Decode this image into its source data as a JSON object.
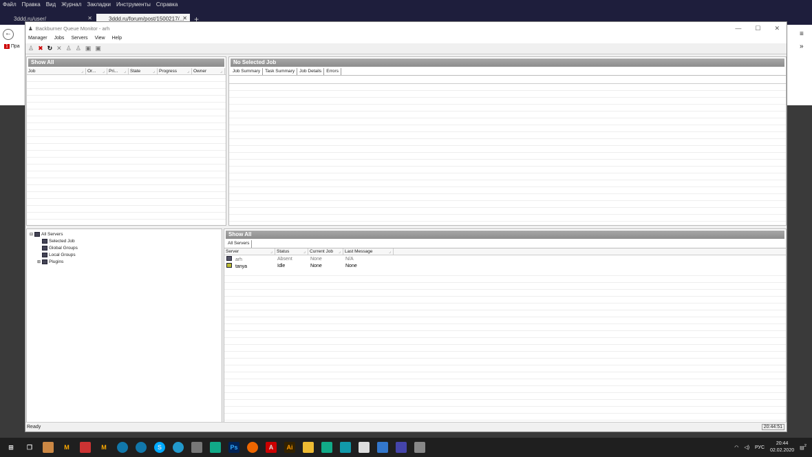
{
  "browser": {
    "menu": [
      "Файл",
      "Правка",
      "Вид",
      "Журнал",
      "Закладки",
      "Инструменты",
      "Справка"
    ],
    "tabs": [
      {
        "label": "3ddd.ru/user/"
      },
      {
        "label": "3ddd.ru/forum/post/1500217/..."
      }
    ],
    "bookmark": "Пра"
  },
  "window": {
    "title": "Backburner Queue Monitor - arh",
    "controls": [
      "—",
      "☐",
      "✕"
    ],
    "menu": [
      "Manager",
      "Jobs",
      "Servers",
      "View",
      "Help"
    ]
  },
  "jobs": {
    "header": "Show All",
    "columns": [
      "Job",
      "Or...",
      "Pri...",
      "State",
      "Progress",
      "Owner"
    ]
  },
  "detail": {
    "header": "No Selected Job",
    "tabs": [
      "Job Summary",
      "Task Summary",
      "Job Details",
      "Errors"
    ]
  },
  "tree": {
    "root": "All Servers",
    "items": [
      "Selected Job",
      "Global Groups",
      "Local Groups",
      "Plugins"
    ]
  },
  "servers": {
    "header": "Show All",
    "tab": "All Servers",
    "columns": [
      "Server",
      "Status",
      "Current Job",
      "Last Message"
    ],
    "rows": [
      {
        "server": "arh",
        "status": "Absent",
        "job": "None",
        "message": "N/A"
      },
      {
        "server": "tanya",
        "status": "Idle",
        "job": "None",
        "message": "None"
      }
    ]
  },
  "status": {
    "text": "Ready",
    "clock": "20:44:51"
  },
  "taskbar": {
    "lang": "РУС",
    "time": "20:44",
    "date": "02.02.2020",
    "notifications": "2"
  }
}
